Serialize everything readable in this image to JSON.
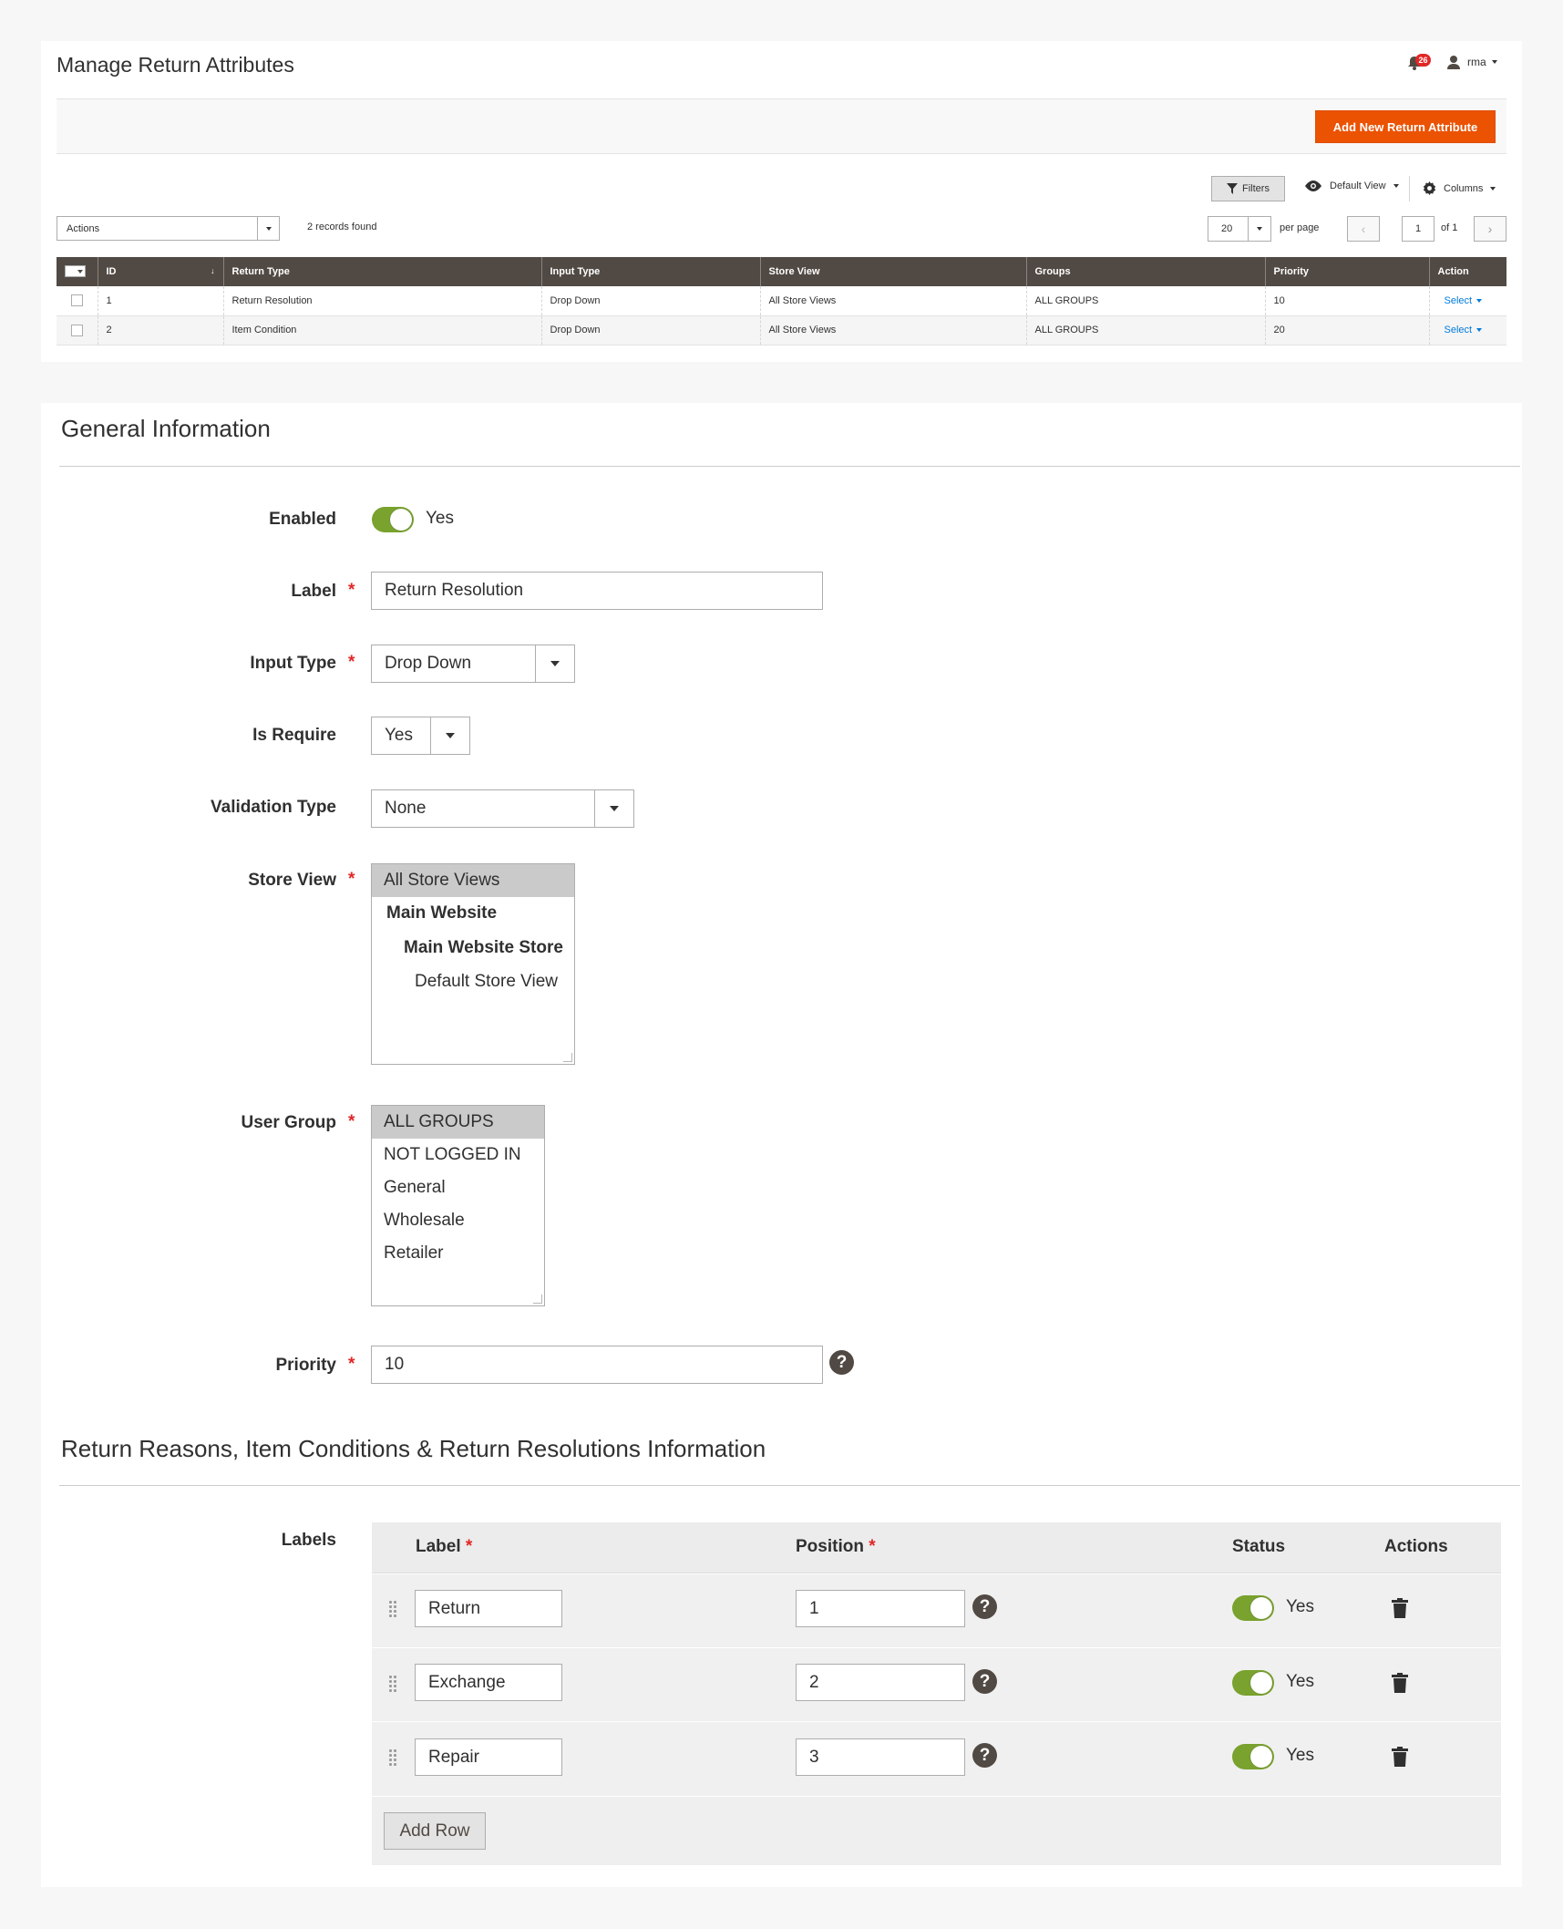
{
  "header": {
    "title": "Manage Return Attributes",
    "notifications_count": "26",
    "user_name": "rma",
    "add_button": "Add New Return Attribute"
  },
  "grid": {
    "filters_label": "Filters",
    "view_label": "Default View",
    "columns_label": "Columns",
    "actions_label": "Actions",
    "records_found": "2 records found",
    "per_page_value": "20",
    "per_page_label": "per page",
    "page_value": "1",
    "page_of": "of 1",
    "columns": [
      "ID",
      "Return Type",
      "Input Type",
      "Store View",
      "Groups",
      "Priority",
      "Action"
    ],
    "rows": [
      {
        "id": "1",
        "return_type": "Return Resolution",
        "input_type": "Drop Down",
        "store_view": "All Store Views",
        "groups": "ALL GROUPS",
        "priority": "10",
        "action": "Select"
      },
      {
        "id": "2",
        "return_type": "Item Condition",
        "input_type": "Drop Down",
        "store_view": "All Store Views",
        "groups": "ALL GROUPS",
        "priority": "20",
        "action": "Select"
      }
    ]
  },
  "general": {
    "title": "General Information",
    "enabled_label": "Enabled",
    "enabled_value": "Yes",
    "label_label": "Label",
    "label_value": "Return Resolution",
    "input_type_label": "Input Type",
    "input_type_value": "Drop Down",
    "is_require_label": "Is Require",
    "is_require_value": "Yes",
    "validation_label": "Validation Type",
    "validation_value": "None",
    "store_view_label": "Store View",
    "store_view_options": [
      "All Store Views",
      "Main Website",
      "Main Website Store",
      "Default Store View"
    ],
    "user_group_label": "User Group",
    "user_group_options": [
      "ALL GROUPS",
      "NOT LOGGED IN",
      "General",
      "Wholesale",
      "Retailer"
    ],
    "priority_label": "Priority",
    "priority_value": "10"
  },
  "reasons": {
    "title": "Return Reasons, Item Conditions & Return Resolutions Information",
    "labels_label": "Labels",
    "col_label": "Label",
    "col_position": "Position",
    "col_status": "Status",
    "col_actions": "Actions",
    "rows": [
      {
        "label": "Return",
        "position": "1",
        "status": "Yes"
      },
      {
        "label": "Exchange",
        "position": "2",
        "status": "Yes"
      },
      {
        "label": "Repair",
        "position": "3",
        "status": "Yes"
      }
    ],
    "add_row": "Add Row"
  },
  "colors": {
    "accent": "#eb5202",
    "header_dark": "#514943",
    "toggle_on": "#79a22e",
    "link": "#007bdb",
    "required": "#e22626"
  }
}
